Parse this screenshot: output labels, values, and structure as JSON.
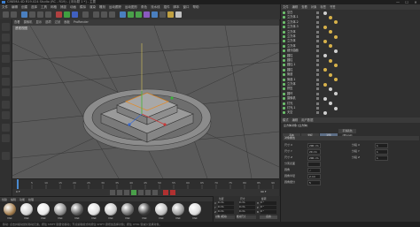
{
  "window": {
    "title": "CINEMA 4D R19.024 Studio (RC - R19) - [未标题 1 *] - 主要",
    "minimize": "—",
    "maximize": "☐",
    "close": "✕"
  },
  "menu": [
    "文件",
    "编辑",
    "创建",
    "选择",
    "工具",
    "网格",
    "捕捉",
    "动画",
    "模拟",
    "渲染",
    "雕刻",
    "运动跟踪",
    "运动图形",
    "角色",
    "流水线",
    "插件",
    "脚本",
    "窗口",
    "帮助"
  ],
  "viewport": {
    "menu": [
      "查看",
      "摄像机",
      "显示",
      "选项",
      "过滤",
      "面板",
      "ProRender"
    ],
    "label": "透视视图"
  },
  "objects_header": [
    "文件",
    "编辑",
    "查看",
    "对象",
    "标签",
    "书签"
  ],
  "objects": [
    {
      "name": "空白",
      "tag_color": "#d0d0d0"
    },
    {
      "name": "立方体.1",
      "tag_color": "#d8b24a"
    },
    {
      "name": "立方体.2",
      "tag_color": "#d8b24a"
    },
    {
      "name": "立方体.3",
      "tag_color": "#d8b24a"
    },
    {
      "name": "立方体",
      "tag_color": "#d8b24a"
    },
    {
      "name": "立方体",
      "tag_color": "#d8b24a"
    },
    {
      "name": "立方体",
      "tag_color": "#d8b24a"
    },
    {
      "name": "立方体",
      "tag_color": "#d8b24a"
    },
    {
      "name": "细分曲面",
      "tag_color": "#d0d0d0"
    },
    {
      "name": "圆柱",
      "tag_color": "#d0d0d0"
    },
    {
      "name": "圆柱",
      "tag_color": "#d8b24a"
    },
    {
      "name": "圆柱.1",
      "tag_color": "#d8b24a"
    },
    {
      "name": "圆柱",
      "tag_color": "#d8b24a"
    },
    {
      "name": "管道",
      "tag_color": "#d8b24a"
    },
    {
      "name": "管道.1",
      "tag_color": "#d8b24a"
    },
    {
      "name": "立方体",
      "tag_color": "#d8b24a"
    },
    {
      "name": "挤压",
      "tag_color": "#d0d0d0"
    },
    {
      "name": "圆环",
      "tag_color": "#d0d0d0"
    },
    {
      "name": "摄像机",
      "tag_color": "#d0d0d0"
    },
    {
      "name": "灯光",
      "tag_color": "#d0d0d0"
    },
    {
      "name": "灯光.1",
      "tag_color": "#d0d0d0"
    },
    {
      "name": "天空",
      "tag_color": "#d0d0d0"
    }
  ],
  "attributes": {
    "header": [
      "模式",
      "编辑",
      "用户数据"
    ],
    "object_name": "立方体对象 [立方体]",
    "tabs": [
      "基本",
      "坐标",
      "对象",
      "平滑着色(Phong)"
    ],
    "section": "对象属性",
    "fields": [
      {
        "label": "尺寸 X",
        "value": "200 cm"
      },
      {
        "label": "尺寸 Y",
        "value": "20 cm"
      },
      {
        "label": "尺寸 Z",
        "value": "200 cm"
      },
      {
        "label": "分段 X",
        "value": "1"
      },
      {
        "label": "分段 Y",
        "value": "1"
      },
      {
        "label": "分段 Z",
        "value": "1"
      },
      {
        "label": "分离表面",
        "value": ""
      },
      {
        "label": "圆角",
        "value": "✓"
      },
      {
        "label": "圆角半径",
        "value": "2 cm"
      },
      {
        "label": "圆角细分",
        "value": "5"
      }
    ]
  },
  "timeline": {
    "ticks": [
      "0",
      "5",
      "10",
      "15",
      "20",
      "25",
      "30",
      "35",
      "40",
      "45",
      "50",
      "55",
      "60",
      "65",
      "70",
      "75",
      "80",
      "85",
      "90"
    ],
    "current_frame": "0 F",
    "end_frame": "90 F"
  },
  "materials": {
    "menu": [
      "创建",
      "编辑",
      "功能",
      "纹理"
    ],
    "items": [
      "Mat",
      "Mat",
      "Mat",
      "Mat",
      "Mat",
      "Mat",
      "Mat",
      "Mat",
      "Mat",
      "Mat",
      "Mat",
      "Mat"
    ]
  },
  "coords": {
    "headers": [
      "位置",
      "尺寸",
      "旋转"
    ],
    "rows": [
      {
        "axis": "X",
        "pos": "0 cm",
        "size": "0 cm",
        "rot_label": "H",
        "rot": "0 °"
      },
      {
        "axis": "Y",
        "pos": "0 cm",
        "size": "0 cm",
        "rot_label": "P",
        "rot": "0 °"
      },
      {
        "axis": "Z",
        "pos": "0 cm",
        "size": "0 cm",
        "rot_label": "B",
        "rot": "0 °"
      }
    ],
    "mode": "对象 (相对)",
    "size_mode": "绝对尺寸",
    "apply": "应用"
  },
  "status": "移动: 点击并拖动鼠标移动元素。按住 SHIFT 键量化移动；节点编辑模式时按住 SHIFT 键增加选择对象；按住 CTRL 键减少选择对象。"
}
